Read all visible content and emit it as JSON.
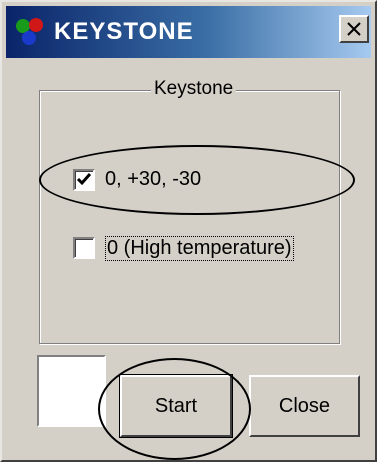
{
  "window": {
    "title": "KEYSTONE",
    "title_gradient": [
      "#0a246a",
      "#a6caf0"
    ],
    "close_icon": "close-x-icon",
    "app_icon": "rgb-dots-icon"
  },
  "group": {
    "label": "Keystone",
    "options": [
      {
        "label": "0, +30, -30",
        "checked": true
      },
      {
        "label": "0 (High temperature)",
        "checked": false
      }
    ]
  },
  "buttons": {
    "start_label": "Start",
    "close_label": "Close"
  }
}
